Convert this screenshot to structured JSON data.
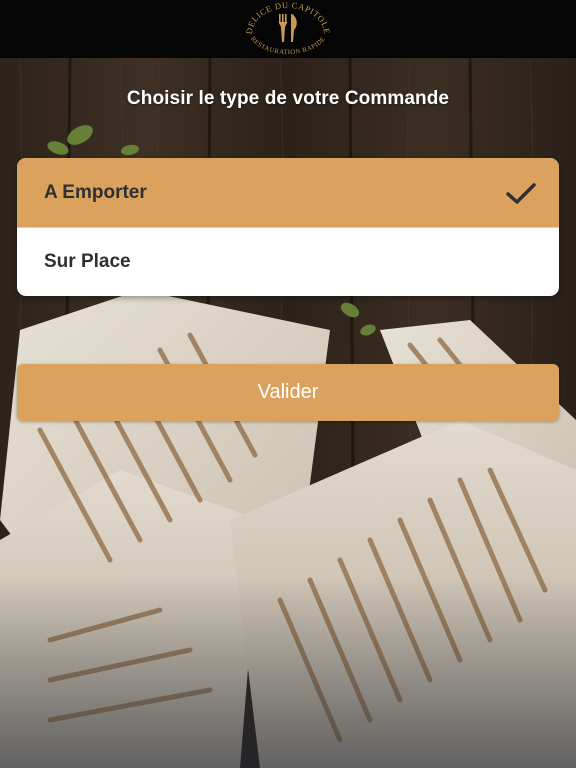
{
  "logo": {
    "text_top": "DELICE DU CAPITOLE",
    "text_bottom": "RESTAURATION RAPIDE",
    "icon": "fork-knife-logo-icon"
  },
  "title": "Choisir le type de votre Commande",
  "options": [
    {
      "label": "A Emporter",
      "selected": true,
      "icon": "checkmark-icon"
    },
    {
      "label": "Sur Place",
      "selected": false
    }
  ],
  "submit_label": "Valider",
  "colors": {
    "accent": "#dba25e",
    "header": "#050505",
    "option_text": "#2f2f2f",
    "card": "#ffffff"
  }
}
